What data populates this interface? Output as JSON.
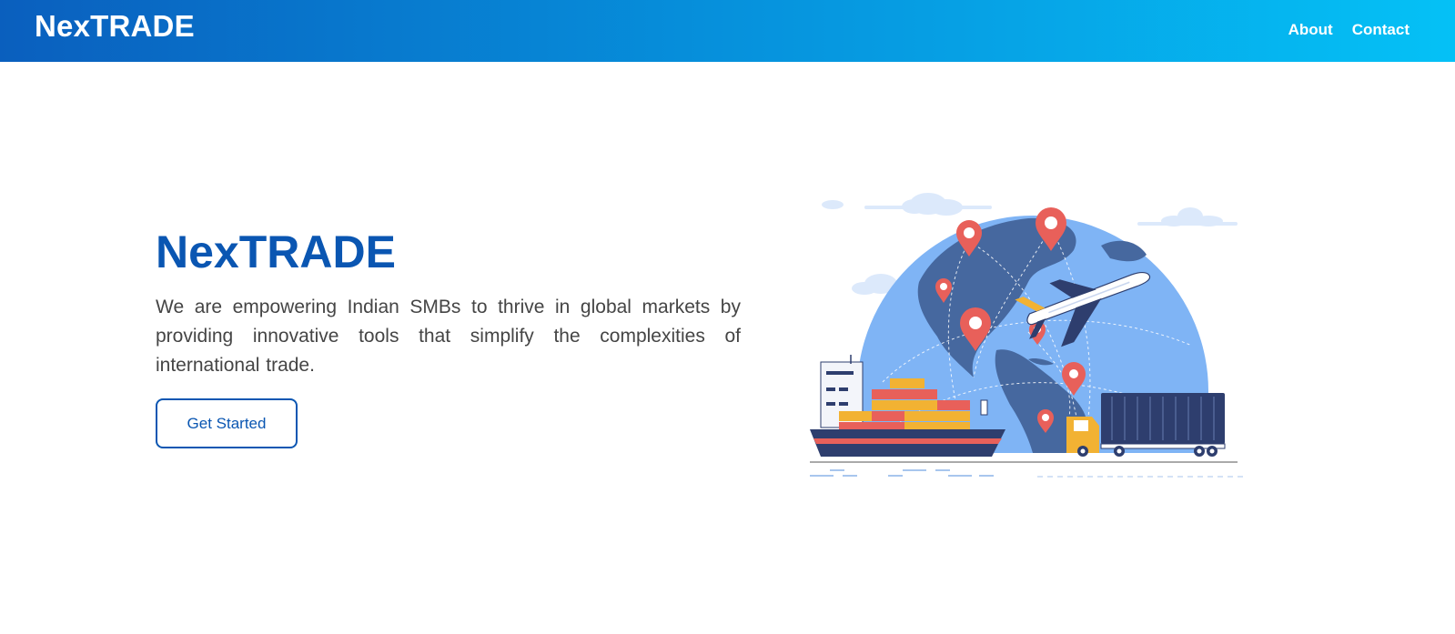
{
  "navbar": {
    "brand": "NexTRADE",
    "links": [
      {
        "label": "About"
      },
      {
        "label": "Contact"
      }
    ],
    "gradient_colors": [
      "#0a5fbe",
      "#05c1f6"
    ]
  },
  "hero": {
    "title": "NexTRADE",
    "description": "We are empowering Indian SMBs to thrive in global markets by providing innovative tools that simplify the complexities of international trade.",
    "cta_label": "Get Started",
    "accent_color": "#0a56b2"
  },
  "illustration": {
    "subject": "global-trade-illustration",
    "icons": [
      "globe-icon",
      "map-pin-icon",
      "airplane-icon",
      "cargo-ship-icon",
      "container-truck-icon",
      "cloud-icon"
    ]
  }
}
